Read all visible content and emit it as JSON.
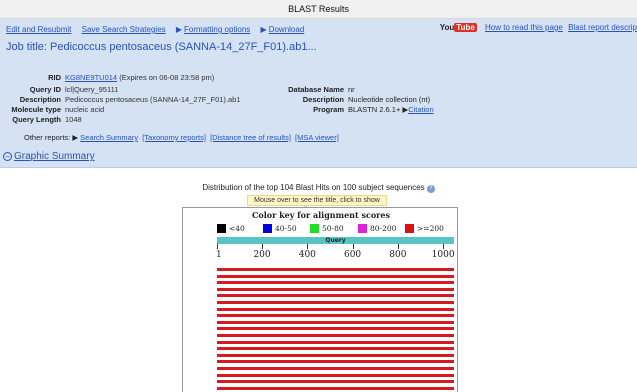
{
  "window": {
    "title": "BLAST Results"
  },
  "toplinks": {
    "edit_resubmit": "Edit and Resubmit",
    "save_strategies": "Save Search Strategies",
    "formatting_arrow": "▶",
    "formatting": "Formatting options",
    "download_arrow": "▶",
    "download": "Download"
  },
  "rightlinks": {
    "youtube_you": "You",
    "youtube_tube": "Tube",
    "how_to_read": "How to read this page",
    "blast_report": "Blast report descrip"
  },
  "job": {
    "title": "Job title: Pedicoccus pentosaceus (SANNA-14_27F_F01).ab1..."
  },
  "meta_left": {
    "rid_label": "RID",
    "rid_value": "KG8NE9TU014",
    "rid_expires": "(Expires on 06-08 23:58 pm)",
    "query_id_label": "Query ID",
    "query_id_value": "lcl|Query_95111",
    "description_label": "Description",
    "description_value": "Pedicoccus pentosaceus (SANNA-14_27F_F01).ab1",
    "molecule_label": "Molecule type",
    "molecule_value": "nucleic acid",
    "length_label": "Query Length",
    "length_value": "1048"
  },
  "meta_right": {
    "db_label": "Database Name",
    "db_value": "nr",
    "desc_label": "Description",
    "desc_value": "Nucleotide collection (nt)",
    "program_label": "Program",
    "program_value": "BLASTN 2.6.1+",
    "citation_arrow": "▶",
    "citation": "Citation"
  },
  "other_reports": {
    "label": "Other reports:",
    "arrow": "▶",
    "search_summary": "Search Summary",
    "taxonomy": "[Taxonomy reports]",
    "distance_tree": "[Distance tree of results]",
    "msa_viewer": "[MSA viewer]"
  },
  "graphic_summary": {
    "toggle": "−",
    "title": "Graphic Summary",
    "distribution": "Distribution of the top 104 Blast Hits on 100 subject sequences",
    "help_icon": "?",
    "hint": "Mouse over to see the title, click to show alignments"
  },
  "color_key": {
    "title": "Color key for alignment scores",
    "items": [
      {
        "label": "<40",
        "color": "#000000"
      },
      {
        "label": "40-50",
        "color": "#0000dd"
      },
      {
        "label": "50-80",
        "color": "#22dd22"
      },
      {
        "label": "80-200",
        "color": "#dd22dd"
      },
      {
        "label": ">=200",
        "color": "#dd1111"
      }
    ]
  },
  "query_axis": {
    "label": "Query",
    "min": 1,
    "max": 1048,
    "ticks": [
      "1",
      "200",
      "400",
      "600",
      "800",
      "1000"
    ],
    "tick_values": [
      1,
      200,
      400,
      600,
      800,
      1000
    ]
  },
  "hits": {
    "visible_rows": 19,
    "color": "#d71920",
    "start": 1,
    "end": 1048
  }
}
